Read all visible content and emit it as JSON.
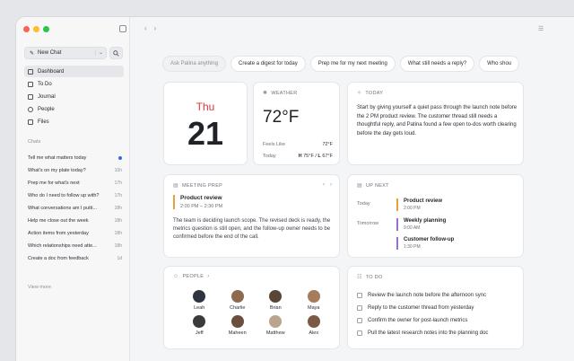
{
  "sidebar": {
    "new_chat_label": "New Chat",
    "nav": [
      {
        "label": "Dashboard",
        "icon": "grid-icon"
      },
      {
        "label": "To Do",
        "icon": "checkbox-icon"
      },
      {
        "label": "Journal",
        "icon": "book-icon"
      },
      {
        "label": "People",
        "icon": "people-icon"
      },
      {
        "label": "Files",
        "icon": "folder-icon"
      }
    ],
    "chats_heading": "Chats",
    "chats": [
      {
        "title": "Tell me what matters today",
        "time": ""
      },
      {
        "title": "What's on my plate today?",
        "time": "10h"
      },
      {
        "title": "Prep me for what's next",
        "time": "17h"
      },
      {
        "title": "Who do I need to follow up with?",
        "time": "17h"
      },
      {
        "title": "What conversations am I putti...",
        "time": "18h"
      },
      {
        "title": "Help me close out the week",
        "time": "18h"
      },
      {
        "title": "Action items from yesterday",
        "time": "18h"
      },
      {
        "title": "Which relationships need atte...",
        "time": "18h"
      },
      {
        "title": "Create a doc from feedback",
        "time": "1d"
      }
    ],
    "view_more": "View more"
  },
  "chips": {
    "placeholder": "Ask Patina anything",
    "items": [
      "Create a digest for today",
      "Prep me for my next meeting",
      "What still needs a reply?",
      "Who shou"
    ]
  },
  "date": {
    "month": "Thu",
    "day": "21"
  },
  "weather": {
    "heading": "WEATHER",
    "temp": "72°F",
    "feels_label": "Feels Like",
    "feels_value": "72°F",
    "today_label": "Today",
    "high_label": "H",
    "high": "75°F",
    "low_label": "L",
    "low": "67°F"
  },
  "today": {
    "heading": "TODAY",
    "text": "Start by giving yourself a quiet pass through the launch note before the 2 PM product review. The customer thread still needs a thoughtful reply, and Patina found a few open to-dos worth clearing before the day gets loud."
  },
  "meeting": {
    "heading": "MEETING PREP",
    "title": "Product review",
    "time": "2:00 PM – 2:30 PM",
    "body": "The team is deciding launch scope. The revised deck is ready, the metrics question is still open, and the follow-up owner needs to be confirmed before the end of the call."
  },
  "upnext": {
    "heading": "UP NEXT",
    "days": [
      {
        "day": "Today",
        "events": [
          {
            "title": "Product review",
            "time": "2:00 PM",
            "color": "#e8a13a"
          }
        ]
      },
      {
        "day": "Tomorrow",
        "events": [
          {
            "title": "Weekly planning",
            "time": "9:00 AM",
            "color": "#9b6fd1"
          },
          {
            "title": "Customer follow-up",
            "time": "1:30 PM",
            "color": "#9b6fd1"
          }
        ]
      }
    ]
  },
  "people": {
    "heading": "PEOPLE",
    "list": [
      {
        "name": "Leah",
        "color": "#2e3440"
      },
      {
        "name": "Charlie",
        "color": "#8c6a4f"
      },
      {
        "name": "Brian",
        "color": "#5a4636"
      },
      {
        "name": "Maya",
        "color": "#a67c5b"
      },
      {
        "name": "Jeff",
        "color": "#3b3b3b"
      },
      {
        "name": "Maheen",
        "color": "#6b4e3d"
      },
      {
        "name": "Matthew",
        "color": "#b9a48e"
      },
      {
        "name": "Alex",
        "color": "#7a5a44"
      }
    ]
  },
  "todo": {
    "heading": "TO DO",
    "items": [
      "Review the launch note before the afternoon sync",
      "Reply to the customer thread from yesterday",
      "Confirm the owner for post-launch metrics",
      "Pull the latest research notes into the planning doc"
    ]
  },
  "colors": {
    "accent": "#2f6fe0",
    "date_red": "#d83a3a"
  }
}
